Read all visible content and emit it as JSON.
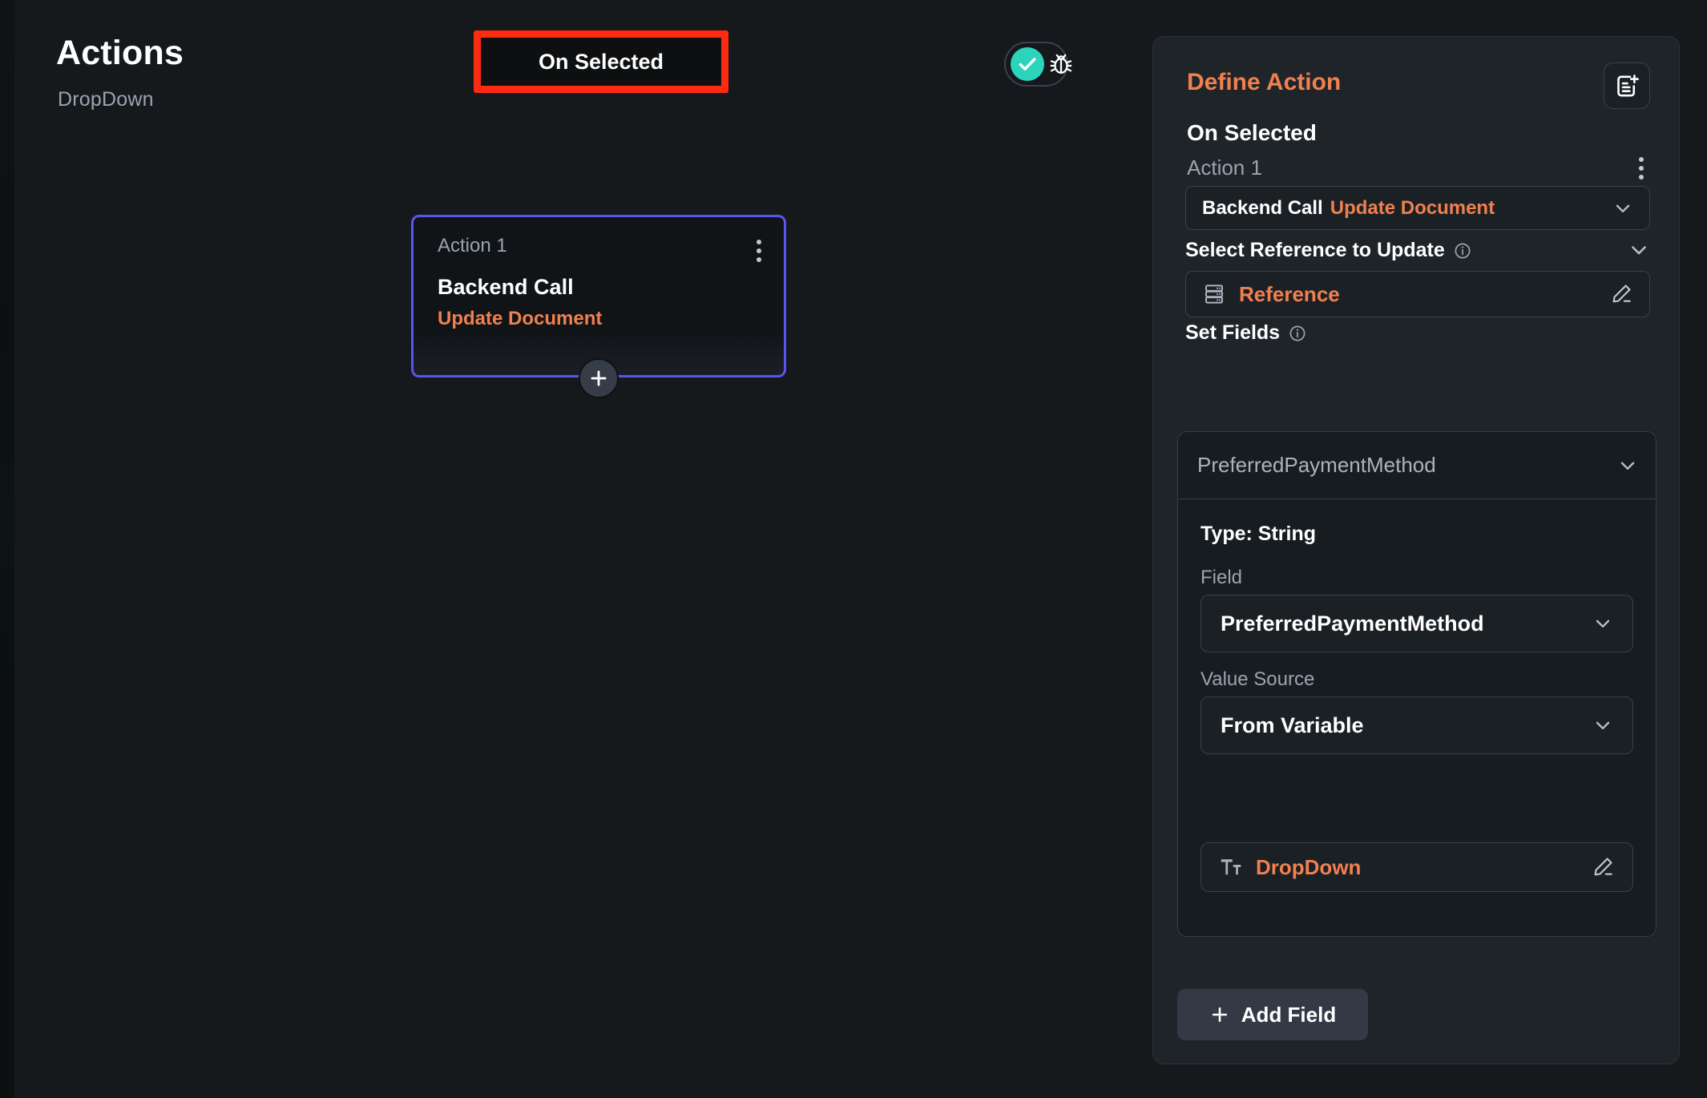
{
  "header": {
    "title": "Actions",
    "subtitle": "DropDown",
    "tab_label": "On Selected",
    "highlight_color": "#ff2a12",
    "toggle": {
      "check_icon": "check-icon",
      "bug_icon": "bug-icon",
      "active_color": "#2cd4bc"
    }
  },
  "canvas": {
    "card": {
      "label": "Action 1",
      "title": "Backend Call",
      "subtitle": "Update Document",
      "accent_color": "#f08050",
      "border_color": "#5b54f0",
      "menu_icon": "kebab-menu-icon"
    },
    "add_node_icon": "plus-icon"
  },
  "panel": {
    "title": "Define Action",
    "title_color": "#f08050",
    "new_action_icon": "note-add-icon",
    "trigger": "On Selected",
    "action_label": "Action 1",
    "menu_icon": "kebab-menu-icon",
    "action_select": {
      "type_label": "Backend Call",
      "operation_label": "Update Document",
      "chevron_icon": "chevron-down-icon"
    },
    "reference_section": {
      "heading": "Select Reference to Update",
      "info_icon": "info-icon",
      "collapse_icon": "chevron-down-icon",
      "row": {
        "icon": "database-icon",
        "label": "Reference",
        "edit_icon": "pencil-icon"
      }
    },
    "set_fields_section": {
      "heading": "Set Fields",
      "info_icon": "info-icon",
      "field_picker": {
        "value": "PreferredPaymentMethod",
        "chevron_icon": "chevron-down-icon"
      },
      "type_line": "Type: String",
      "field_label": "Field",
      "field_value": "PreferredPaymentMethod",
      "field_chevron_icon": "chevron-down-icon",
      "value_source_label": "Value Source",
      "value_source_value": "From Variable",
      "value_source_chevron_icon": "chevron-down-icon",
      "variable_row": {
        "icon": "text-format-icon",
        "label": "DropDown",
        "edit_icon": "pencil-icon"
      }
    },
    "add_field_label": "Add Field",
    "add_field_icon": "plus-icon"
  }
}
